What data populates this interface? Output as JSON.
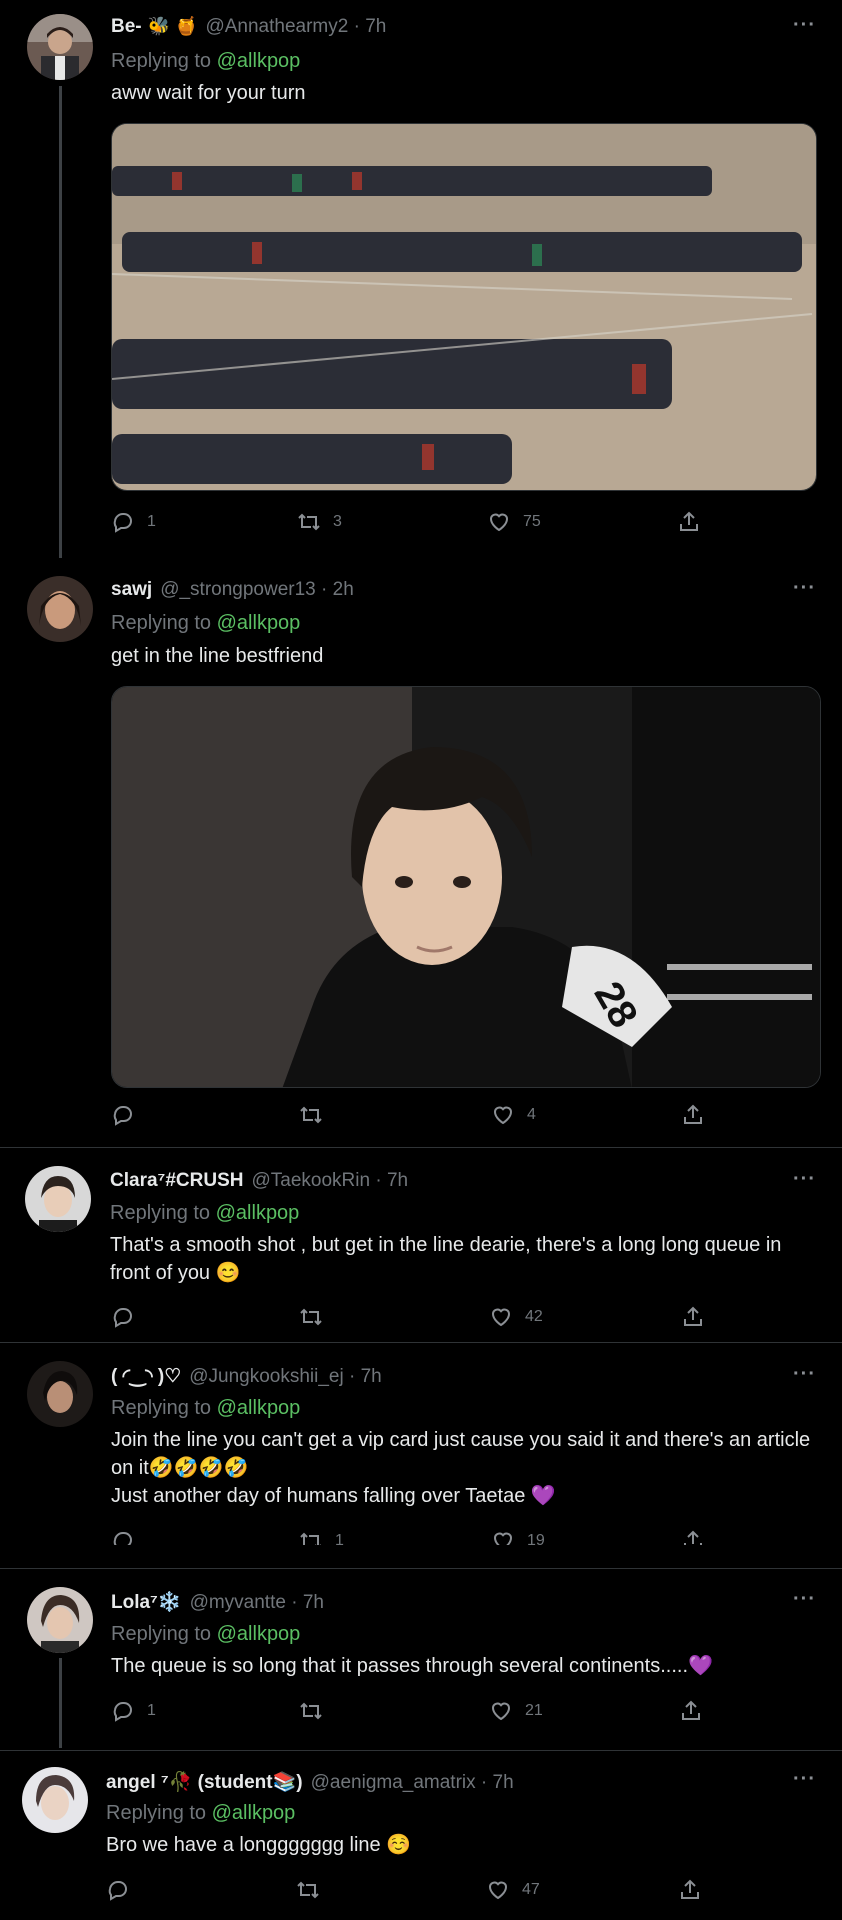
{
  "tweets": [
    {
      "name": "Be-",
      "emojis": "🐝 🍯",
      "handle": "@Annathearmy2 · 7h",
      "replying": "Replying to",
      "mention": "@allkpop",
      "text": "aww wait for your turn",
      "reply_count": "1",
      "retweet_count": "3",
      "like_count": "75",
      "has_thread_line": true
    },
    {
      "name": "sawj",
      "emojis": "",
      "handle": "@_strongpower13 · 2h",
      "replying": "Replying to",
      "mention": "@allkpop",
      "text": "get in the line bestfriend",
      "reply_count": "",
      "retweet_count": "",
      "like_count": "4"
    },
    {
      "name": "Clara⁷#CRUSH",
      "emojis": "",
      "handle": "@TaekookRin · 7h",
      "replying": "Replying to",
      "mention": "@allkpop",
      "text": "That's a smooth shot , but get in the line dearie, there's a long long  queue in front of you 😊",
      "reply_count": "",
      "retweet_count": "",
      "like_count": "42"
    },
    {
      "name": "( ◜‿◝ )♡",
      "emojis": "",
      "handle": "@Jungkookshii_ej · 7h",
      "replying": "Replying to",
      "mention": "@allkpop",
      "text": "Join the line you can't get a vip card just cause you said it and there's an article on it🤣🤣🤣🤣",
      "text2": "Just another day of humans falling over Taetae 💜",
      "reply_count": "",
      "retweet_count": "1",
      "like_count": "19"
    },
    {
      "name": "Lola⁷❄️",
      "emojis": "",
      "handle": "@myvantte · 7h",
      "replying": "Replying to",
      "mention": "@allkpop",
      "text": "The queue is so long that it passes through several continents.....💜",
      "reply_count": "1",
      "retweet_count": "",
      "like_count": "21"
    },
    {
      "name": "angel ⁷🥀 (student📚)",
      "emojis": "",
      "handle": "@aenigma_amatrix · 7h",
      "replying": "Replying to",
      "mention": "@allkpop",
      "text": "Bro we have a longgggggg line ☺️",
      "reply_count": "",
      "retweet_count": "",
      "like_count": "47"
    }
  ],
  "more_glyph": "···",
  "colors": {
    "background": "#000000",
    "text": "#e7e9ea",
    "muted": "#71767b",
    "mention": "#5bbf63",
    "divider": "#2f3336"
  }
}
